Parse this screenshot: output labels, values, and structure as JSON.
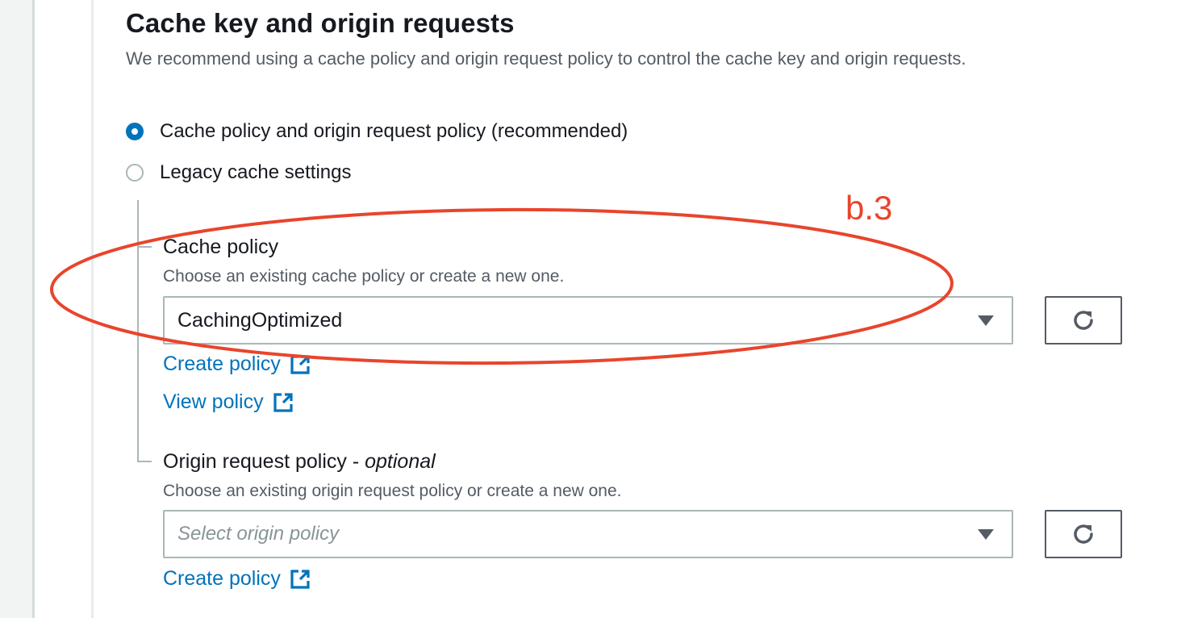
{
  "section": {
    "title": "Cache key and origin requests",
    "description": "We recommend using a cache policy and origin request policy to control the cache key and origin requests."
  },
  "radio_options": [
    {
      "label": "Cache policy and origin request policy (recommended)",
      "selected": true
    },
    {
      "label": "Legacy cache settings",
      "selected": false
    }
  ],
  "cache_policy": {
    "label": "Cache policy",
    "description": "Choose an existing cache policy or create a new one.",
    "selected_value": "CachingOptimized",
    "create_link": "Create policy",
    "view_link": "View policy"
  },
  "origin_request_policy": {
    "label": "Origin request policy - ",
    "label_optional": "optional",
    "description": "Choose an existing origin request policy or create a new one.",
    "placeholder": "Select origin policy",
    "create_link": "Create policy"
  },
  "annotation": {
    "text": "b.3",
    "color": "#e8452c"
  },
  "colors": {
    "accent": "#0073bb",
    "text": "#16191f",
    "muted": "#545b64",
    "border": "#aab7b8"
  },
  "icons": {
    "external_link": "external-link-icon",
    "refresh": "refresh-icon",
    "caret": "caret-down-icon"
  }
}
